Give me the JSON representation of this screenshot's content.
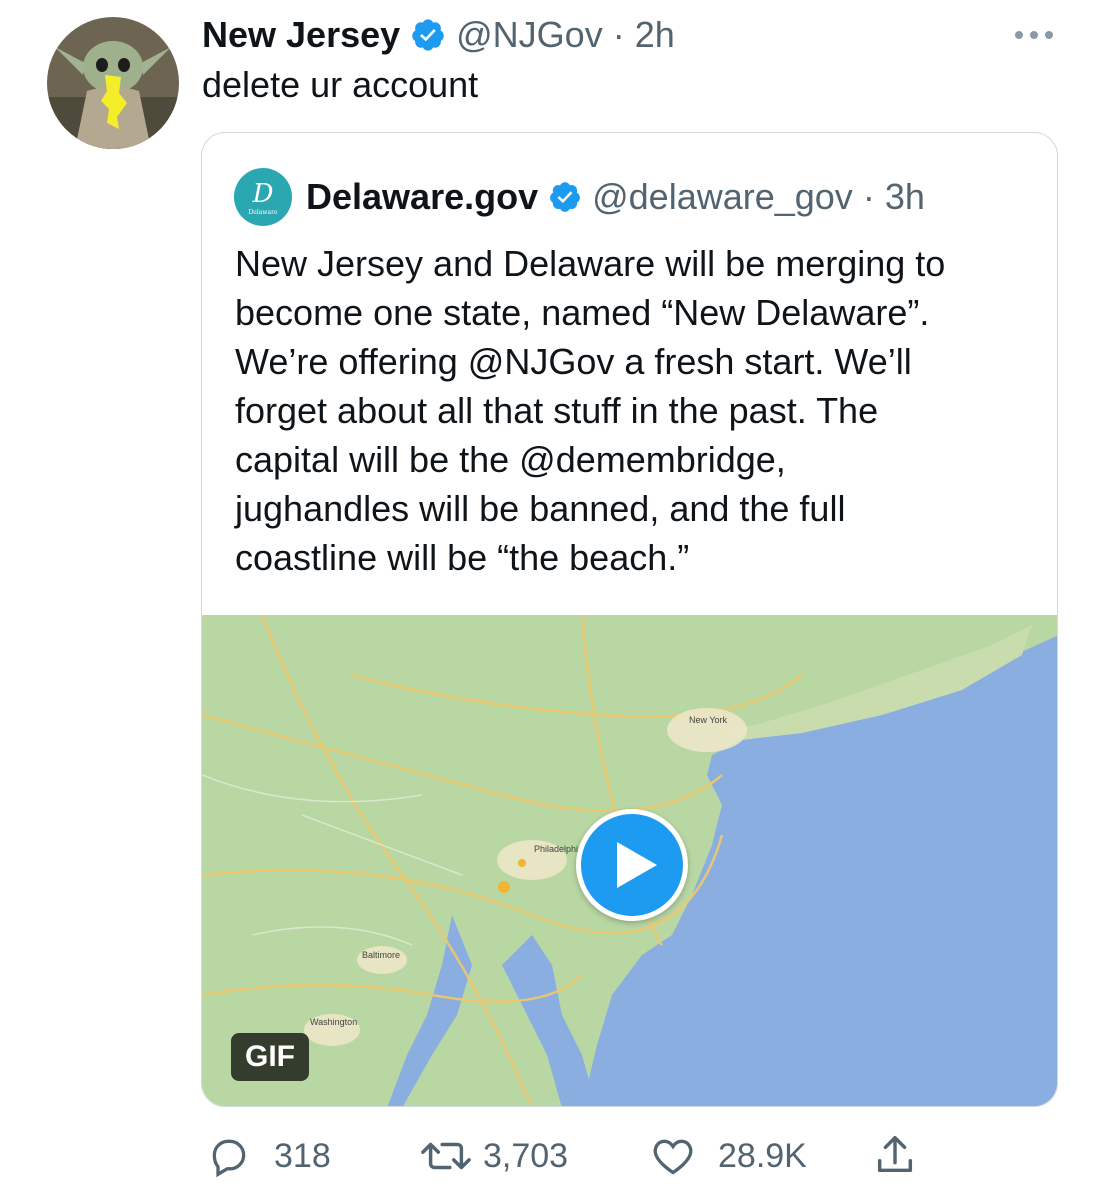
{
  "tweet": {
    "author_name": "New Jersey",
    "author_handle": "@NJGov",
    "time": "2h",
    "text": "delete ur account"
  },
  "quoted_tweet": {
    "author_name": "Delaware.gov",
    "author_handle": "@delaware_gov",
    "time": "3h",
    "text": "New Jersey and Delaware will be merging to\nbecome one state, named “New Delaware”.\nWe’re offering @NJGov a fresh start. We’ll\nforget about all that stuff in the past. The\ncapital will be the @demembridge,\njughandles will be banned, and the full\ncoastline will be “the beach.”",
    "media_badge": "GIF",
    "map_labels": {
      "new_york": "New York",
      "philadelphia": "Philadelphia",
      "baltimore": "Baltimore",
      "washington": "Washington"
    }
  },
  "actions": {
    "replies": "318",
    "retweets": "3,703",
    "likes": "28.9K"
  },
  "icons": {
    "verified": "verified-badge-icon",
    "more": "more-options-icon",
    "reply": "reply-icon",
    "retweet": "retweet-icon",
    "like": "heart-icon",
    "share": "share-icon",
    "play": "play-icon"
  },
  "colors": {
    "accent": "#1d9bf0",
    "secondary_text": "#536471",
    "ocean": "#8aaee0",
    "land": "#b9d7a3"
  }
}
